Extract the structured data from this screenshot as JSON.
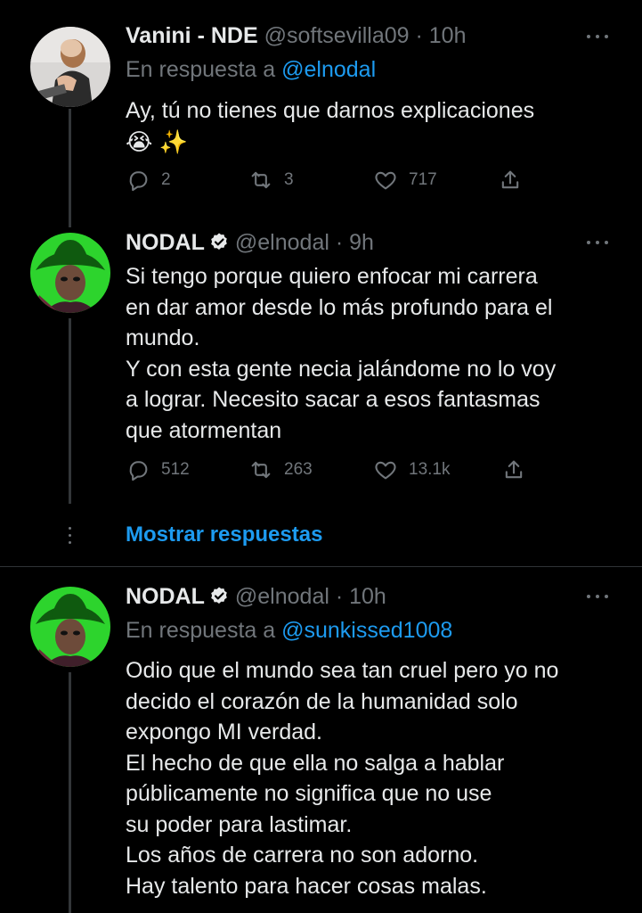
{
  "tweets": [
    {
      "name": "Vanini - NDE",
      "handle": "@softsevilla09 · 10h",
      "reply_prefix": "En respuesta a",
      "reply_to": "@elnodal",
      "lines": [
        "Ay, tú no tienes que darnos explicaciones"
      ],
      "emoji_line": "😭 ✨",
      "replies": "2",
      "retweets": "3",
      "likes": "717"
    },
    {
      "name": "NODAL",
      "handle": "@elnodal · 9h",
      "lines": [
        "Si tengo porque quiero enfocar mi carrera",
        "en dar amor desde lo más profundo para el",
        "mundo.",
        "Y con esta gente necia jalándome no lo voy",
        "a lograr. Necesito sacar a esos fantasmas",
        "que atormentan"
      ],
      "replies": "512",
      "retweets": "263",
      "likes": "13.1k"
    },
    {
      "name": "NODAL",
      "handle": "@elnodal · 10h",
      "reply_prefix": "En respuesta a",
      "reply_to": "@sunkissed1008",
      "lines": [
        "Odio que el mundo sea tan cruel pero yo no",
        "decido el corazón de la humanidad solo",
        "expongo MI verdad.",
        "El hecho de que ella no salga a hablar",
        "públicamente no significa que no use",
        "su poder para lastimar.",
        "Los años de carrera no son adorno.",
        "Hay talento para hacer cosas malas."
      ]
    }
  ],
  "show_replies_label": "Mostrar respuestas",
  "colors": {
    "background": "#000000",
    "text": "#e7e9ea",
    "muted": "#71767b",
    "link": "#1d9bf0",
    "separator": "#2f3336",
    "avatar_green": "#2dd42d"
  }
}
